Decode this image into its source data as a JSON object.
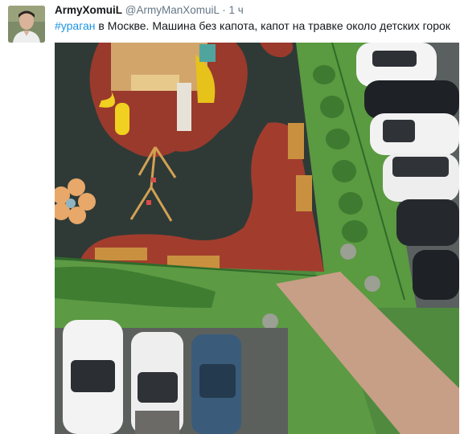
{
  "tweet": {
    "display_name": "ArmyXomuiL",
    "handle": "@ArmyManXomuiL",
    "separator": "·",
    "time": "1 ч",
    "hashtag": "#ураган",
    "text": " в Москве. Машина без капота, капот на травке около детских горок"
  },
  "media": {
    "description_icon": "photo"
  },
  "colors": {
    "link": "#1b95e0",
    "muted": "#657786"
  }
}
